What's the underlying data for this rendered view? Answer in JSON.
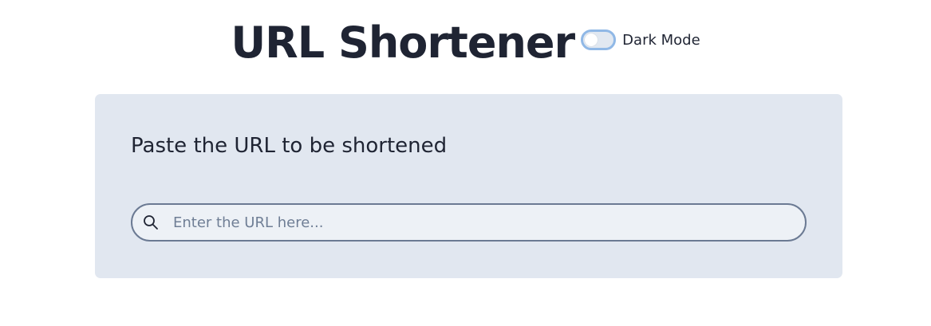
{
  "header": {
    "title": "URL Shortener",
    "dark_mode_label": "Dark Mode",
    "dark_mode_enabled": false
  },
  "card": {
    "heading": "Paste the URL to be shortened",
    "search": {
      "placeholder": "Enter the URL here...",
      "value": "",
      "icon": "search-icon"
    }
  },
  "colors": {
    "title_text": "#1f2433",
    "card_background": "#e1e7f0",
    "input_background": "#edf1f6",
    "input_border": "#6b7a93",
    "toggle_border": "#90b8e6"
  }
}
